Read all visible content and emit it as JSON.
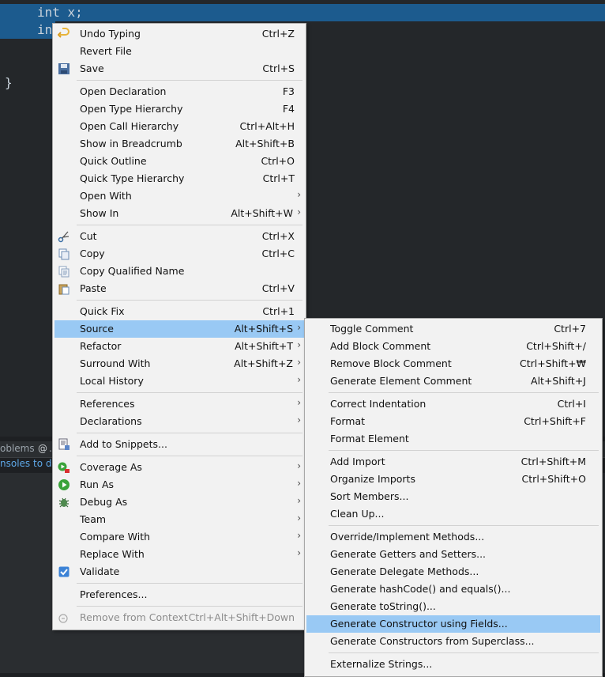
{
  "editor": {
    "line1": "int x;",
    "line2": "in",
    "brace": "}"
  },
  "tabs": {
    "problems": "oblems",
    "at": "@",
    "dot": "."
  },
  "console_message": "nsoles to disp",
  "context_menu": {
    "groups": [
      [
        {
          "label": "Undo Typing",
          "shortcut": "Ctrl+Z",
          "icon": "undo-icon"
        },
        {
          "label": "Revert File",
          "shortcut": ""
        },
        {
          "label": "Save",
          "shortcut": "Ctrl+S",
          "icon": "save-icon"
        }
      ],
      [
        {
          "label": "Open Declaration",
          "shortcut": "F3"
        },
        {
          "label": "Open Type Hierarchy",
          "shortcut": "F4"
        },
        {
          "label": "Open Call Hierarchy",
          "shortcut": "Ctrl+Alt+H"
        },
        {
          "label": "Show in Breadcrumb",
          "shortcut": "Alt+Shift+B"
        },
        {
          "label": "Quick Outline",
          "shortcut": "Ctrl+O"
        },
        {
          "label": "Quick Type Hierarchy",
          "shortcut": "Ctrl+T"
        },
        {
          "label": "Open With",
          "shortcut": "",
          "submenu": true
        },
        {
          "label": "Show In",
          "shortcut": "Alt+Shift+W",
          "submenu": true
        }
      ],
      [
        {
          "label": "Cut",
          "shortcut": "Ctrl+X",
          "icon": "scissors-icon"
        },
        {
          "label": "Copy",
          "shortcut": "Ctrl+C",
          "icon": "copy-icon"
        },
        {
          "label": "Copy Qualified Name",
          "shortcut": "",
          "icon": "copy-qualified-icon"
        },
        {
          "label": "Paste",
          "shortcut": "Ctrl+V",
          "icon": "paste-icon"
        }
      ],
      [
        {
          "label": "Quick Fix",
          "shortcut": "Ctrl+1"
        },
        {
          "label": "Source",
          "shortcut": "Alt+Shift+S",
          "submenu": true,
          "highlighted": true
        },
        {
          "label": "Refactor",
          "shortcut": "Alt+Shift+T",
          "submenu": true
        },
        {
          "label": "Surround With",
          "shortcut": "Alt+Shift+Z",
          "submenu": true
        },
        {
          "label": "Local History",
          "shortcut": "",
          "submenu": true
        }
      ],
      [
        {
          "label": "References",
          "shortcut": "",
          "submenu": true
        },
        {
          "label": "Declarations",
          "shortcut": "",
          "submenu": true
        }
      ],
      [
        {
          "label": "Add to Snippets...",
          "shortcut": "",
          "icon": "snippets-icon"
        }
      ],
      [
        {
          "label": "Coverage As",
          "shortcut": "",
          "submenu": true,
          "icon": "coverage-icon"
        },
        {
          "label": "Run As",
          "shortcut": "",
          "submenu": true,
          "icon": "run-icon"
        },
        {
          "label": "Debug As",
          "shortcut": "",
          "submenu": true,
          "icon": "bug-icon"
        },
        {
          "label": "Team",
          "shortcut": "",
          "submenu": true
        },
        {
          "label": "Compare With",
          "shortcut": "",
          "submenu": true
        },
        {
          "label": "Replace With",
          "shortcut": "",
          "submenu": true
        },
        {
          "label": "Validate",
          "shortcut": "",
          "icon": "checkbox-icon"
        }
      ],
      [
        {
          "label": "Preferences...",
          "shortcut": ""
        }
      ],
      [
        {
          "label": "Remove from Context",
          "shortcut": "Ctrl+Alt+Shift+Down",
          "disabled": true,
          "icon": "remove-context-icon"
        }
      ]
    ]
  },
  "source_submenu": {
    "groups": [
      [
        {
          "label": "Toggle Comment",
          "shortcut": "Ctrl+7"
        },
        {
          "label": "Add Block Comment",
          "shortcut": "Ctrl+Shift+/"
        },
        {
          "label": "Remove Block Comment",
          "shortcut": "Ctrl+Shift+₩"
        },
        {
          "label": "Generate Element Comment",
          "shortcut": "Alt+Shift+J"
        }
      ],
      [
        {
          "label": "Correct Indentation",
          "shortcut": "Ctrl+I"
        },
        {
          "label": "Format",
          "shortcut": "Ctrl+Shift+F"
        },
        {
          "label": "Format Element",
          "shortcut": ""
        }
      ],
      [
        {
          "label": "Add Import",
          "shortcut": "Ctrl+Shift+M"
        },
        {
          "label": "Organize Imports",
          "shortcut": "Ctrl+Shift+O"
        },
        {
          "label": "Sort Members...",
          "shortcut": ""
        },
        {
          "label": "Clean Up...",
          "shortcut": ""
        }
      ],
      [
        {
          "label": "Override/Implement Methods...",
          "shortcut": ""
        },
        {
          "label": "Generate Getters and Setters...",
          "shortcut": ""
        },
        {
          "label": "Generate Delegate Methods...",
          "shortcut": ""
        },
        {
          "label": "Generate hashCode() and equals()...",
          "shortcut": ""
        },
        {
          "label": "Generate toString()...",
          "shortcut": ""
        },
        {
          "label": "Generate Constructor using Fields...",
          "shortcut": "",
          "highlighted": true
        },
        {
          "label": "Generate Constructors from Superclass...",
          "shortcut": ""
        }
      ],
      [
        {
          "label": "Externalize Strings...",
          "shortcut": ""
        }
      ]
    ]
  },
  "colors": {
    "selection": "#1c5b8e",
    "highlight": "#99c9f4",
    "menu_bg": "#f2f2f2"
  }
}
